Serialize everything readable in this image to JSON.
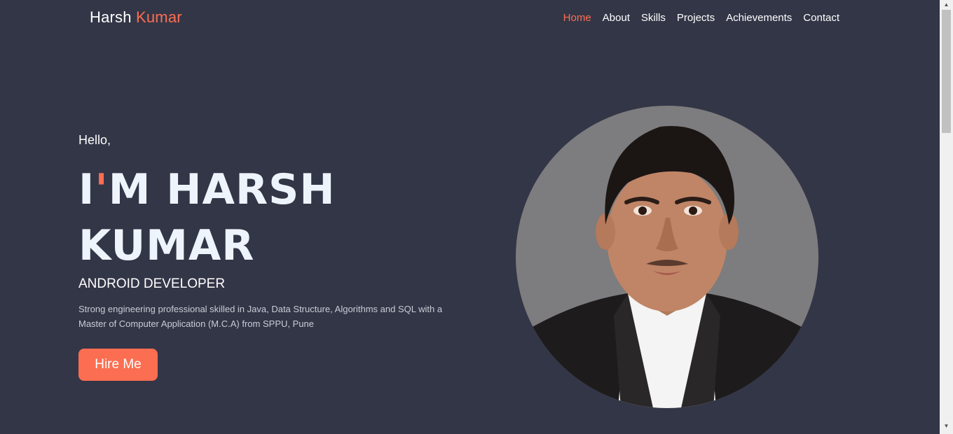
{
  "brand": {
    "first": "Harsh",
    "last": "Kumar"
  },
  "nav": {
    "items": [
      {
        "label": "Home",
        "active": true
      },
      {
        "label": "About"
      },
      {
        "label": "Skills"
      },
      {
        "label": "Projects"
      },
      {
        "label": "Achievements"
      },
      {
        "label": "Contact"
      }
    ]
  },
  "hero": {
    "greeting": "Hello,",
    "headline_prefix": "I",
    "headline_apostrophe": "'",
    "headline_line1_rest": "M HARSH",
    "headline_line2": "KUMAR",
    "role": "ANDROID DEVELOPER",
    "bio": "Strong engineering professional skilled in Java, Data Structure, Algorithms and SQL with a Master of Computer Application (M.C.A) from SPPU, Pune",
    "cta_label": "Hire Me"
  },
  "colors": {
    "background": "#333647",
    "accent": "#fc6e51",
    "text": "#ffffff"
  },
  "icons": {
    "scroll_up": "triangle-up-icon",
    "scroll_down": "triangle-down-icon"
  }
}
